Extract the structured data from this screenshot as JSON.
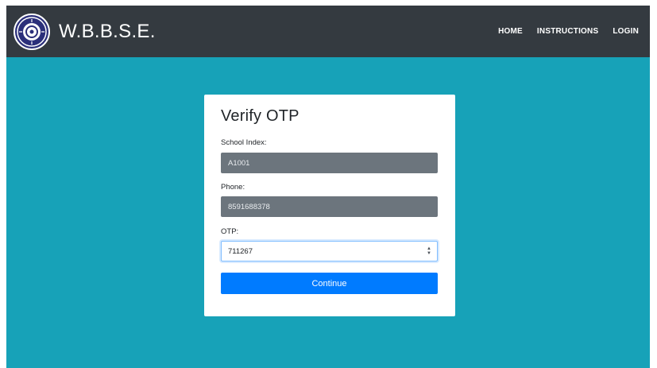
{
  "navbar": {
    "brand": "W.B.B.S.E.",
    "logo_icon": "wbbse-seal-icon",
    "links": [
      "HOME",
      "INSTRUCTIONS",
      "LOGIN"
    ]
  },
  "form": {
    "title": "Verify OTP",
    "school_index": {
      "label": "School Index:",
      "value": "A1001"
    },
    "phone": {
      "label": "Phone:",
      "value": "8591688378"
    },
    "otp": {
      "label": "OTP:",
      "value": "711267"
    },
    "submit_label": "Continue"
  },
  "colors": {
    "page_background": "#17a2b8",
    "navbar": "#343a40",
    "button": "#007bff",
    "readonly_field": "#6c757d"
  }
}
